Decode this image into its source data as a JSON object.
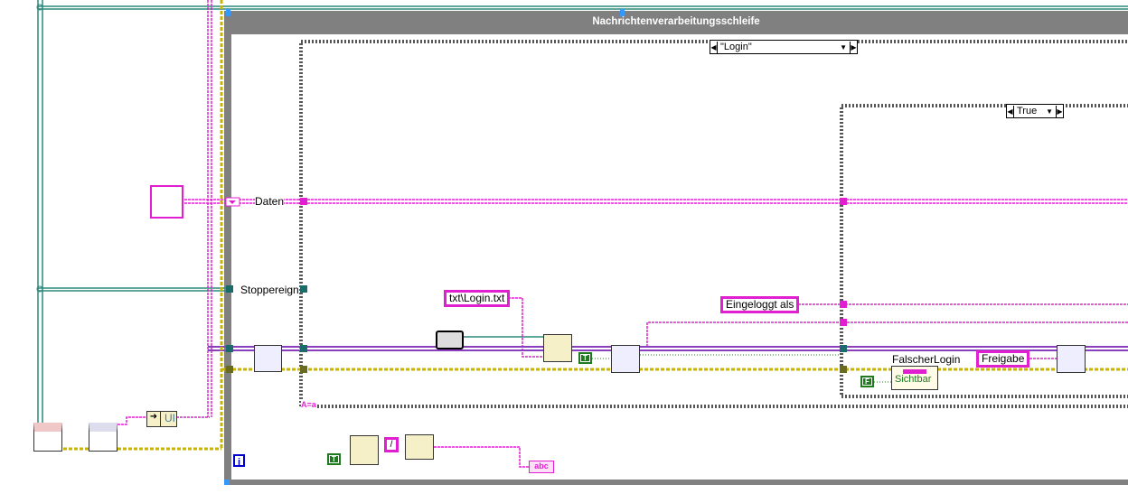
{
  "loop": {
    "title": "Nachrichtenverarbeitungsschleife",
    "info_icon": "i",
    "case_selector_label": "A=a"
  },
  "case_structure": {
    "selected_case": "\"Login\""
  },
  "inner_case": {
    "selected_case": "True"
  },
  "tunnels": {
    "data_label": "Daten",
    "stop_label": "Stoppereign"
  },
  "constants": {
    "login_file": "txt\\Login.txt",
    "logged_in_as": "Eingeloggt als",
    "release": "Freigabe",
    "true_const": "T",
    "false_const": "F"
  },
  "property_node": {
    "control": "FalscherLogin",
    "property": "Sichtbar"
  },
  "ui_node": {
    "label": "UI"
  },
  "string_indicator": {
    "label": "abc"
  },
  "colors": {
    "string_wire": "#e020d0",
    "cluster_wire": "#8a3fbf",
    "error_wire": "#c8b400",
    "refnum_wire": "#2a8a7a",
    "loop_frame": "#808080",
    "bool": "#1f7a1f"
  }
}
